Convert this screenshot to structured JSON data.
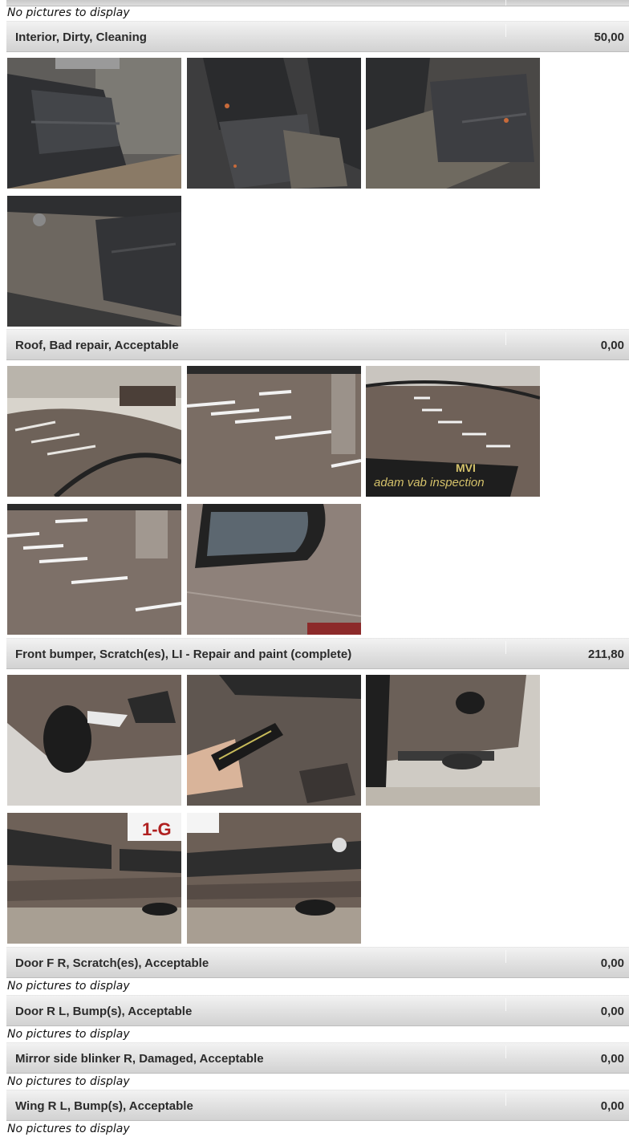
{
  "no_pictures_text": "No pictures to display",
  "damages": [
    {
      "description": "Interior, Dirty, Cleaning",
      "amount": "50,00"
    },
    {
      "description": "Roof, Bad repair, Acceptable",
      "amount": "0,00"
    },
    {
      "description": "Front bumper, Scratch(es), LI - Repair and paint (complete)",
      "amount": "211,80"
    },
    {
      "description": "Door F R, Scratch(es), Acceptable",
      "amount": "0,00"
    },
    {
      "description": "Door R L, Bump(s), Acceptable",
      "amount": "0,00"
    },
    {
      "description": "Mirror side blinker R, Damaged, Acceptable",
      "amount": "0,00"
    },
    {
      "description": "Wing R L, Bump(s), Acceptable",
      "amount": "0,00"
    }
  ],
  "photo_overlays": {
    "ruler_text": "adam vab inspection",
    "ruler_logo": "MVI",
    "plate_text": "1-G"
  }
}
